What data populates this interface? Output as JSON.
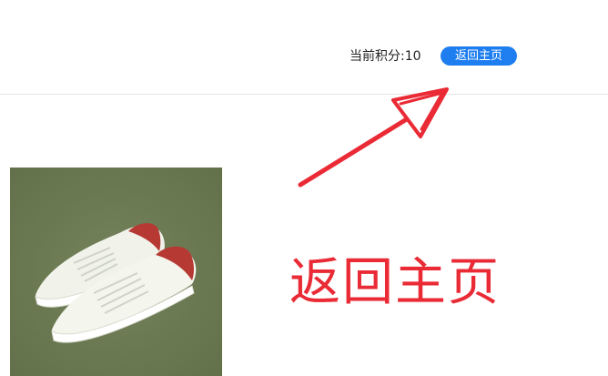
{
  "header": {
    "points_label": "当前积分:10",
    "home_button_label": "返回主页"
  },
  "annotation": {
    "text": "返回主页"
  },
  "product": {
    "image_name": "white-sneakers-image"
  },
  "colors": {
    "accent_blue": "#1e7ef0",
    "annotation_red": "#ea2a35",
    "carpet_green": "#6b7a52"
  }
}
